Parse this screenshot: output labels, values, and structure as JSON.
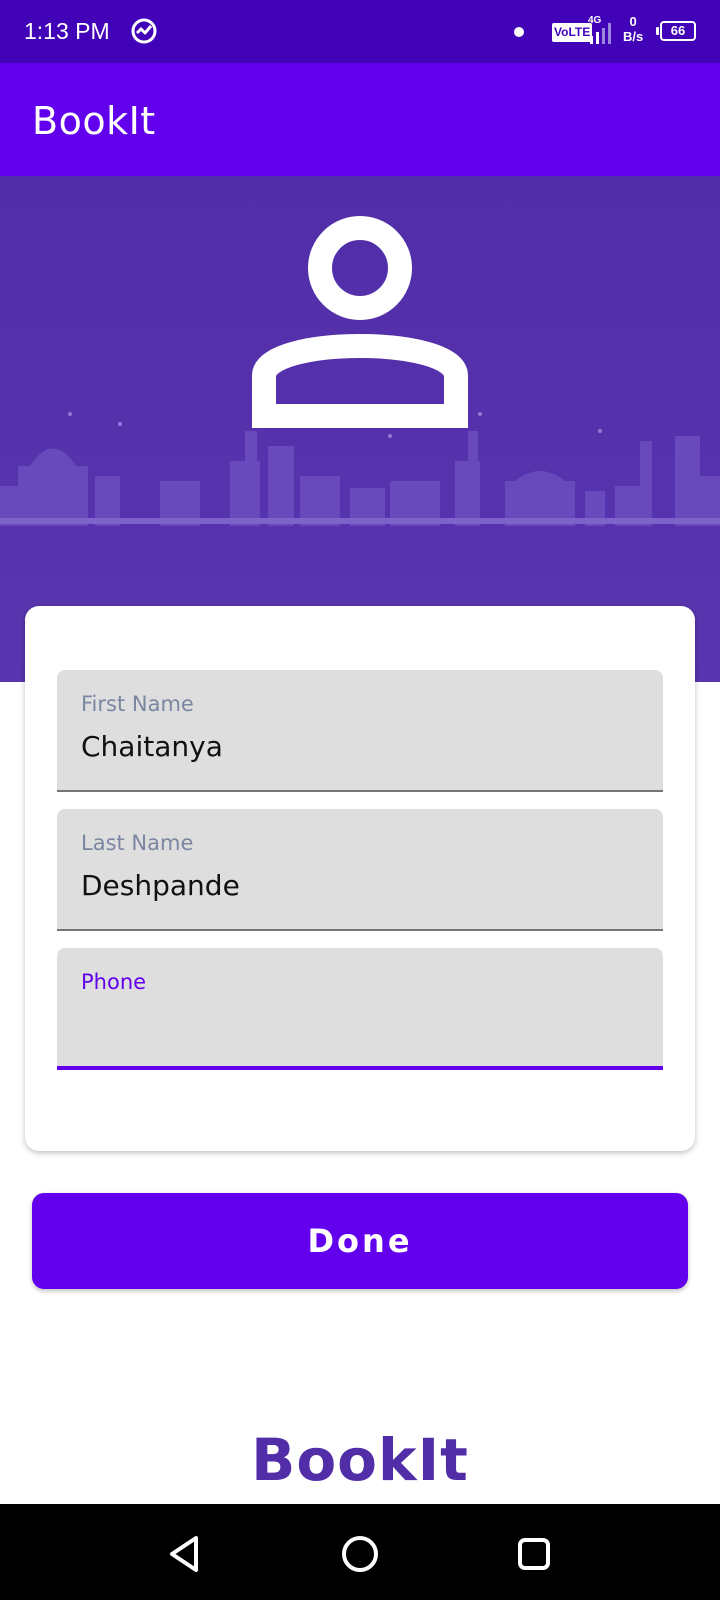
{
  "status_bar": {
    "time": "1:13 PM",
    "volte": "VoLTE",
    "network": "4G",
    "speed_value": "0",
    "speed_unit": "B/s",
    "battery": "66",
    "sync_icon": "sync-icon"
  },
  "app_bar": {
    "title": "BookIt"
  },
  "header": {
    "avatar_icon": "person-icon",
    "illustration": "city-skyline"
  },
  "form": {
    "first_name": {
      "label": "First Name",
      "value": "Chaitanya"
    },
    "last_name": {
      "label": "Last Name",
      "value": "Deshpande"
    },
    "phone": {
      "label": "Phone",
      "value": ""
    }
  },
  "done_label": "Done",
  "footer_logo": "BookIt",
  "nav": {
    "back_icon": "back-triangle-icon",
    "home_icon": "home-circle-icon",
    "recent_icon": "recents-square-icon"
  },
  "colors": {
    "status_bar": "#4203b8",
    "primary": "#6200ee",
    "header": "#512da8",
    "field_bg": "#dedede"
  }
}
